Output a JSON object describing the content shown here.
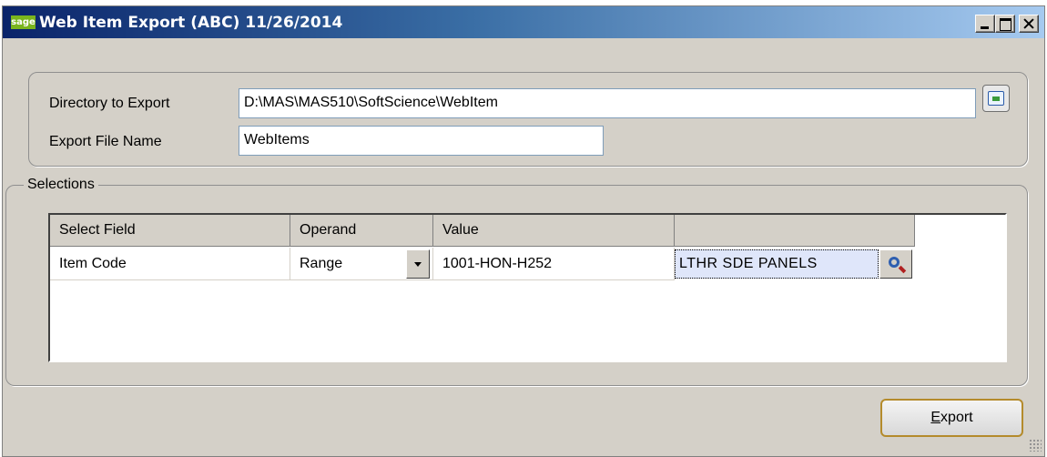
{
  "window": {
    "title": "Web Item  Export (ABC) 11/26/2014",
    "logo_text": "sage"
  },
  "directory": {
    "label": "Directory to Export",
    "value": "D:\\MAS\\MAS510\\SoftScience\\WebItem"
  },
  "export_file": {
    "label": "Export File Name",
    "value": "WebItems"
  },
  "selections": {
    "legend": "Selections",
    "headers": [
      "Select Field",
      "Operand",
      "Value",
      ""
    ],
    "rows": [
      {
        "field": "Item Code",
        "operand": "Range",
        "value": "1001-HON-H252",
        "description": "LTHR SDE PANELS"
      }
    ]
  },
  "buttons": {
    "export_label_underlined": "E",
    "export_label_rest": "xport"
  }
}
